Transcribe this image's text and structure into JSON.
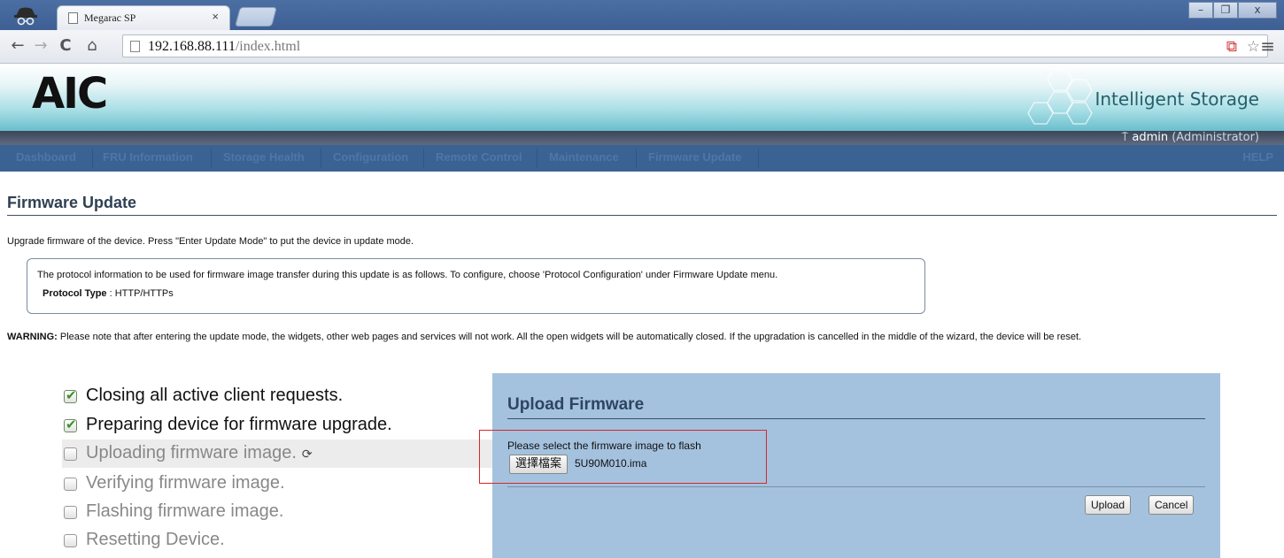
{
  "browser": {
    "tab_title": "Megarac SP",
    "tab_close": "×",
    "url_host": "192.168.88.111",
    "url_path": "/index.html",
    "window_buttons": [
      "–",
      "❐",
      "x"
    ]
  },
  "header": {
    "logo": "AIC",
    "brand": "Intelligent Storage",
    "user": "admin",
    "role": "(Administrator)"
  },
  "nav": {
    "items": [
      "Dashboard",
      "FRU Information",
      "Storage Health",
      "Configuration",
      "Remote Control",
      "Maintenance",
      "Firmware Update"
    ],
    "help": "HELP"
  },
  "page": {
    "title": "Firmware Update",
    "intro": "Upgrade firmware of the device. Press \"Enter Update Mode\" to put the device in update mode.",
    "protocol_info": "The protocol information to be used for firmware image transfer during this update is as follows. To configure, choose 'Protocol Configuration' under Firmware Update menu.",
    "protocol_label": "Protocol Type",
    "protocol_value": " : HTTP/HTTPs",
    "warning_label": "WARNING:",
    "warning_text": " Please note that after entering the update mode, the widgets, other web pages and services will not work. All the open widgets will be automatically closed. If the upgradation is cancelled in the middle of the wizard, the device will be reset."
  },
  "steps": [
    {
      "label": "Closing all active client requests.",
      "checked": true
    },
    {
      "label": "Preparing device for firmware upgrade.",
      "checked": true
    },
    {
      "label": "Uploading firmware image.",
      "checked": false
    },
    {
      "label": "Verifying firmware image.",
      "checked": false
    },
    {
      "label": "Flashing firmware image.",
      "checked": false
    },
    {
      "label": "Resetting Device.",
      "checked": false
    }
  ],
  "upload": {
    "title": "Upload Firmware",
    "prompt": "Please select the firmware image to flash",
    "choose_file_label": "選擇檔案",
    "file_name": "5U90M010.ima",
    "upload_label": "Upload",
    "cancel_label": "Cancel"
  },
  "colors": {
    "nav_bg": "#3a6393",
    "panel_bg": "#a4c2de",
    "highlight_box": "#d9262c"
  }
}
